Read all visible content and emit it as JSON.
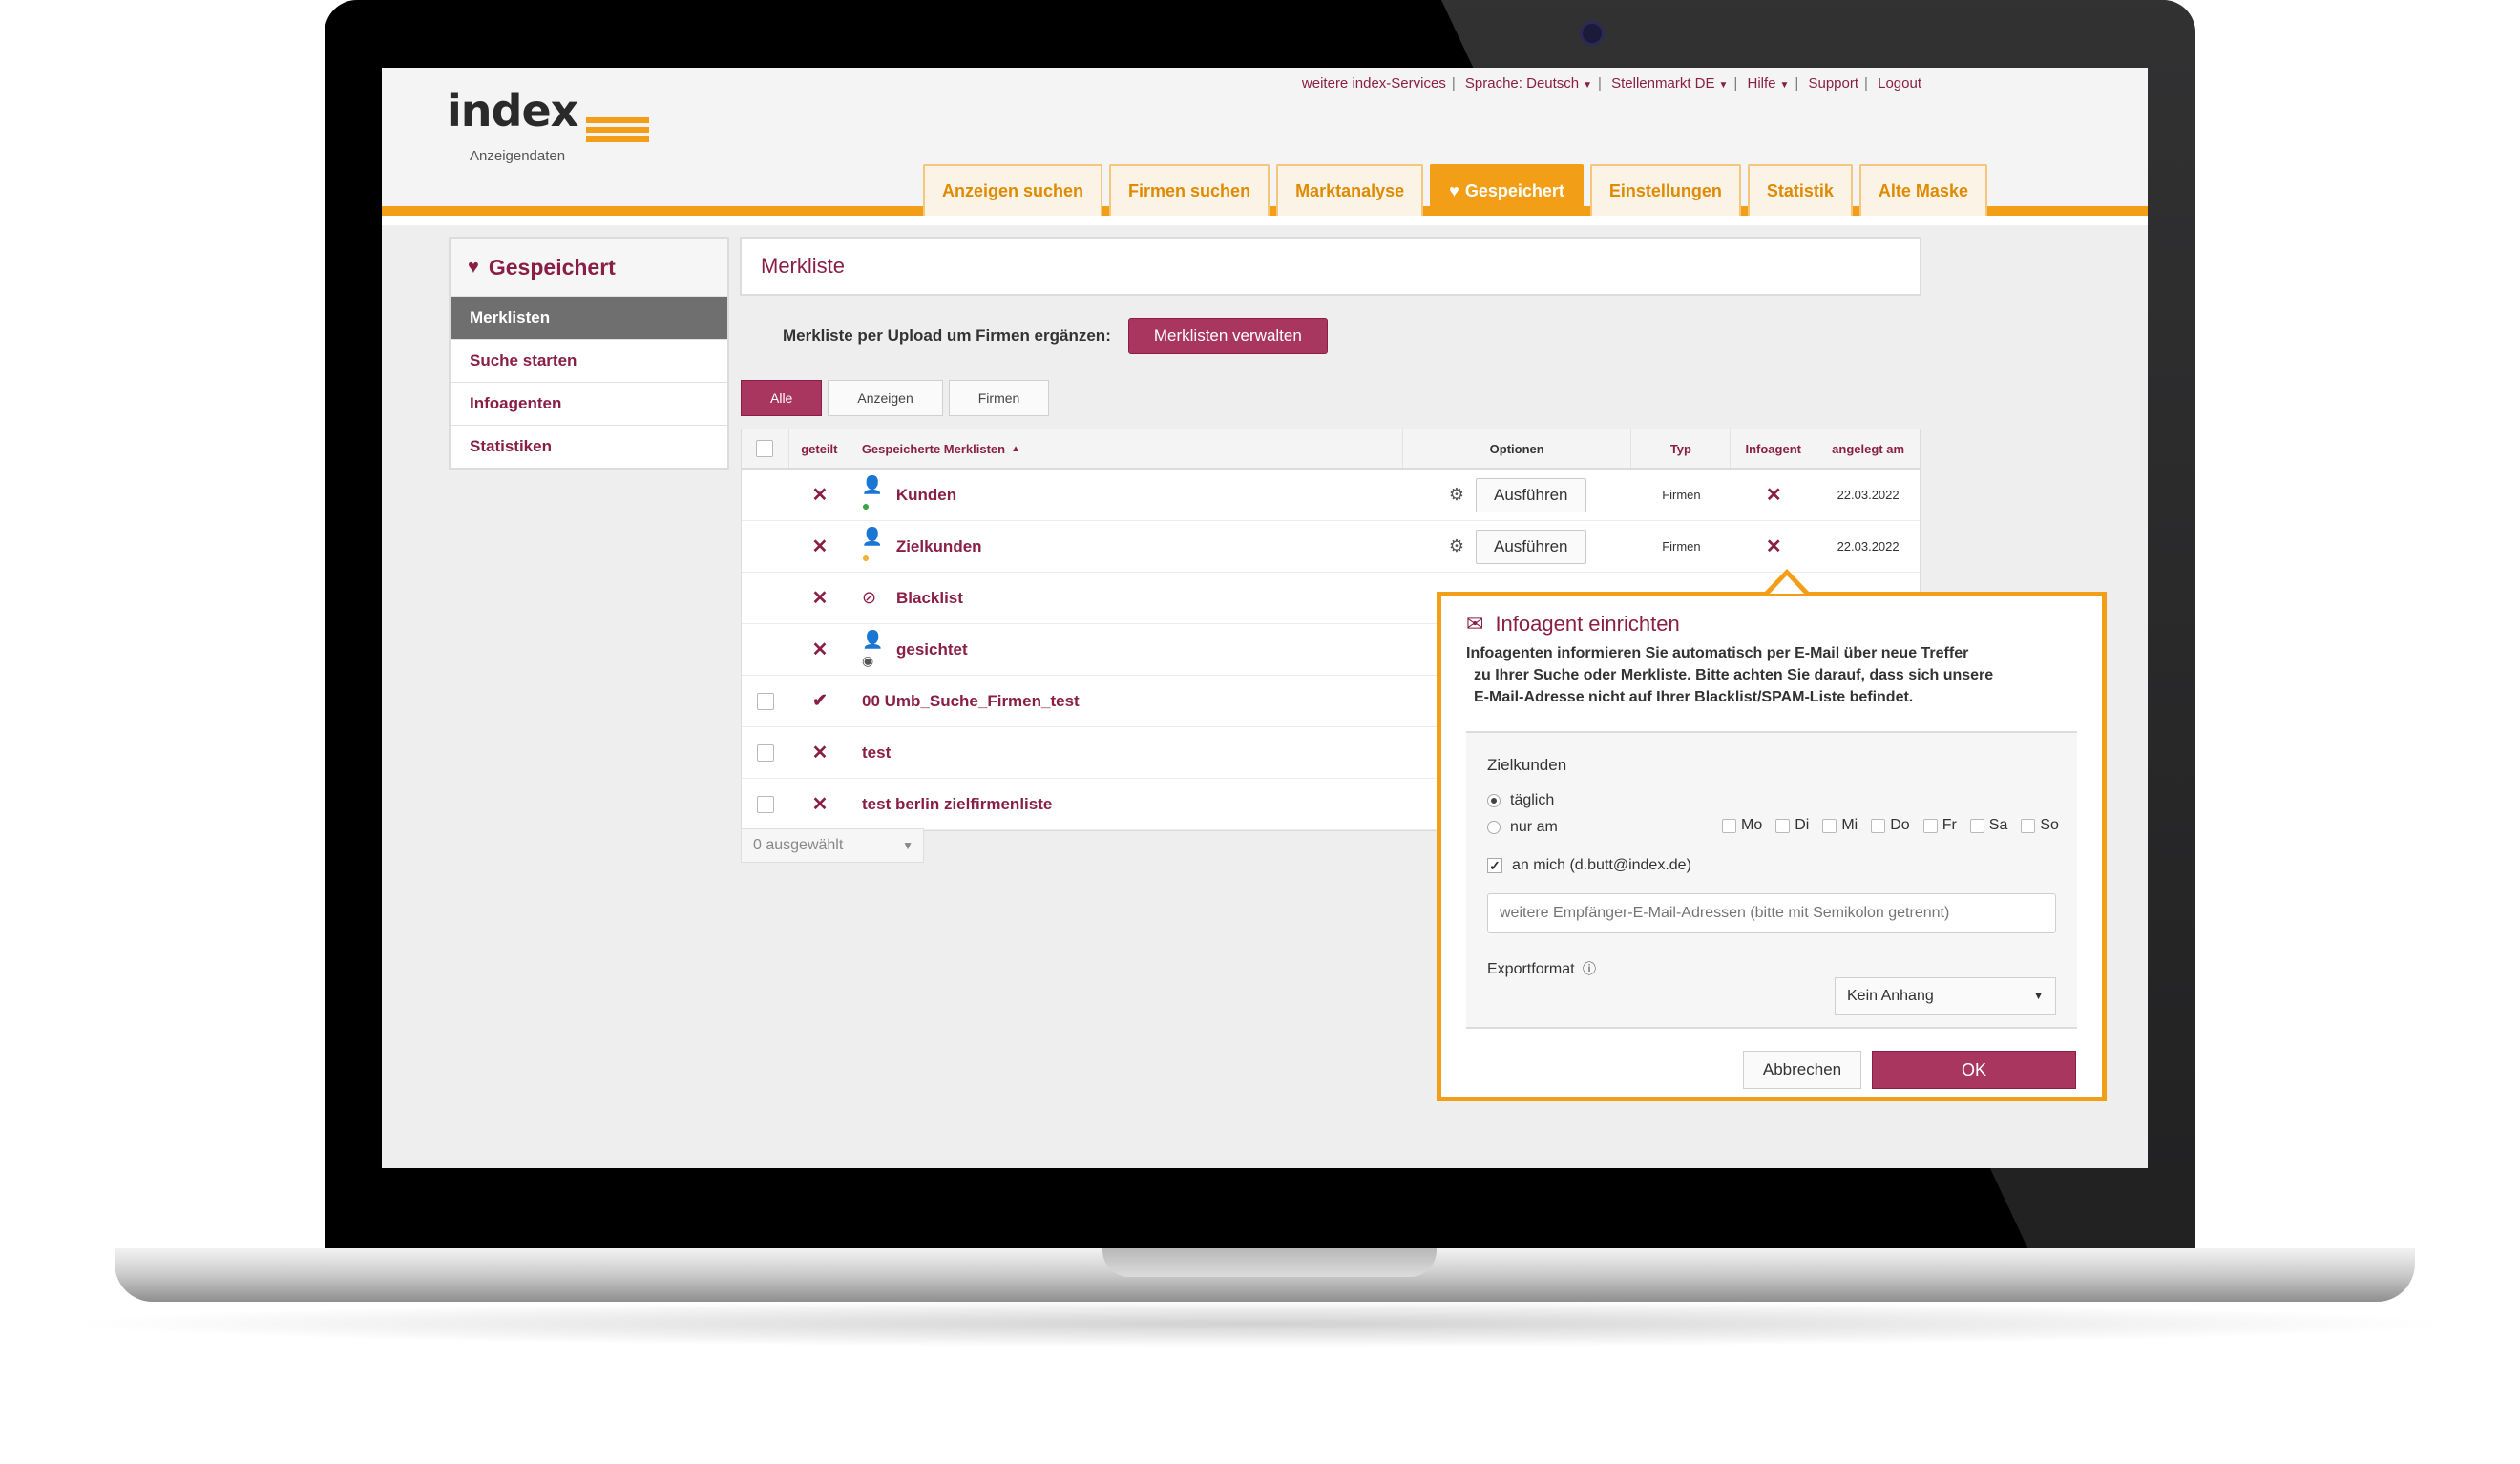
{
  "brand": {
    "name": "index",
    "subtitle": "Anzeigendaten",
    "accent": "#f29f17",
    "primary": "#8a1f45"
  },
  "topnav": {
    "services": "weitere index-Services",
    "language": "Sprache: Deutsch",
    "market": "Stellenmarkt DE",
    "help": "Hilfe",
    "support": "Support",
    "logout": "Logout"
  },
  "tabs": [
    {
      "label": "Anzeigen suchen"
    },
    {
      "label": "Firmen suchen"
    },
    {
      "label": "Marktanalyse"
    },
    {
      "label": "Gespeichert"
    },
    {
      "label": "Einstellungen"
    },
    {
      "label": "Statistik"
    },
    {
      "label": "Alte Maske"
    }
  ],
  "sidebar": {
    "title": "Gespeichert",
    "items": [
      {
        "label": "Merklisten"
      },
      {
        "label": "Suche starten"
      },
      {
        "label": "Infoagenten"
      },
      {
        "label": "Statistiken"
      }
    ]
  },
  "main": {
    "title": "Merkliste",
    "upload_label": "Merkliste per Upload um Firmen ergänzen:",
    "manage_button": "Merklisten verwalten",
    "filters": [
      "Alle",
      "Anzeigen",
      "Firmen"
    ],
    "selected_count": "0 ausgewählt"
  },
  "table": {
    "headers": {
      "shared": "geteilt",
      "name": "Gespeicherte Merklisten",
      "options": "Optionen",
      "type": "Typ",
      "infoagent": "Infoagent",
      "created": "angelegt am"
    },
    "run_label": "Ausführen",
    "rows": [
      {
        "name": "Kunden",
        "shared": "x",
        "icon": "user-check-icon",
        "type": "Firmen",
        "infoagent": "x",
        "created": "22.03.2022"
      },
      {
        "name": "Zielkunden",
        "shared": "x",
        "icon": "user-pending-icon",
        "type": "Firmen",
        "infoagent": "x",
        "created": "22.03.2022"
      },
      {
        "name": "Blacklist",
        "shared": "x",
        "icon": "user-blocked-icon"
      },
      {
        "name": "gesichtet",
        "shared": "x",
        "icon": "user-viewed-icon"
      },
      {
        "name": "00 Umb_Suche_Firmen_test",
        "shared": "check"
      },
      {
        "name": "test",
        "shared": "x"
      },
      {
        "name": "test berlin zielfirmenliste",
        "shared": "x"
      }
    ]
  },
  "modal": {
    "title": "Infoagent einrichten",
    "desc_line1": "Infoagenten informieren Sie automatisch per E-Mail über neue Treffer",
    "desc_line2": "zu Ihrer Suche oder Merkliste. Bitte achten Sie darauf, dass sich unsere",
    "desc_line3": "E-Mail-Adresse nicht auf Ihrer Blacklist/SPAM-Liste befindet.",
    "list_name": "Zielkunden",
    "daily": "täglich",
    "only_on": "nur am",
    "days": [
      "Mo",
      "Di",
      "Mi",
      "Do",
      "Fr",
      "Sa",
      "So"
    ],
    "to_me": "an mich (d.butt@index.de)",
    "email_placeholder": "weitere Empfänger-E-Mail-Adressen (bitte mit Semikolon getrennt)",
    "export_label": "Exportformat",
    "export_value": "Kein Anhang",
    "cancel": "Abbrechen",
    "ok": "OK"
  }
}
